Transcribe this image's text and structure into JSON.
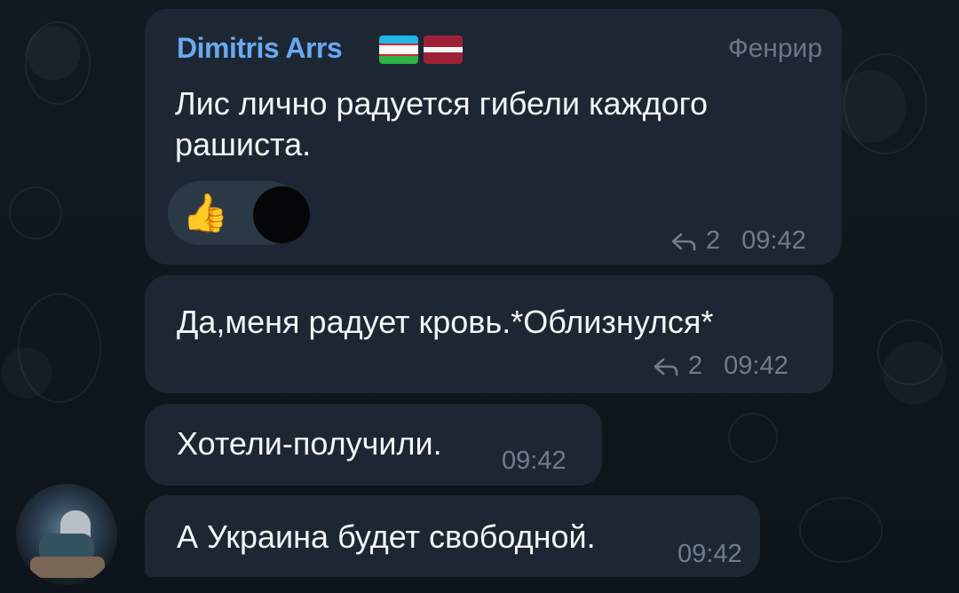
{
  "messages": [
    {
      "sender": "Dimitris Arrs",
      "sender_color": "#6aa9f1",
      "flags": [
        "uzbekistan-flag",
        "latvia-flag"
      ],
      "role": "Фенрир",
      "text_lines": [
        "Лис лично радуется гибели каждого",
        "рашиста."
      ],
      "reaction_emoji": "👍",
      "reply_count": "2",
      "time": "09:42"
    },
    {
      "text": "Да,меня радует кровь.*Облизнулся*",
      "reply_count": "2",
      "time": "09:42"
    },
    {
      "text": "Хотели-получили.",
      "time": "09:42"
    },
    {
      "text": "А Украина будет свободной.",
      "time": "09:42"
    }
  ],
  "colors": {
    "bubble": "#1d2733",
    "background": "#0f161d",
    "meta": "#6f7d8a"
  }
}
